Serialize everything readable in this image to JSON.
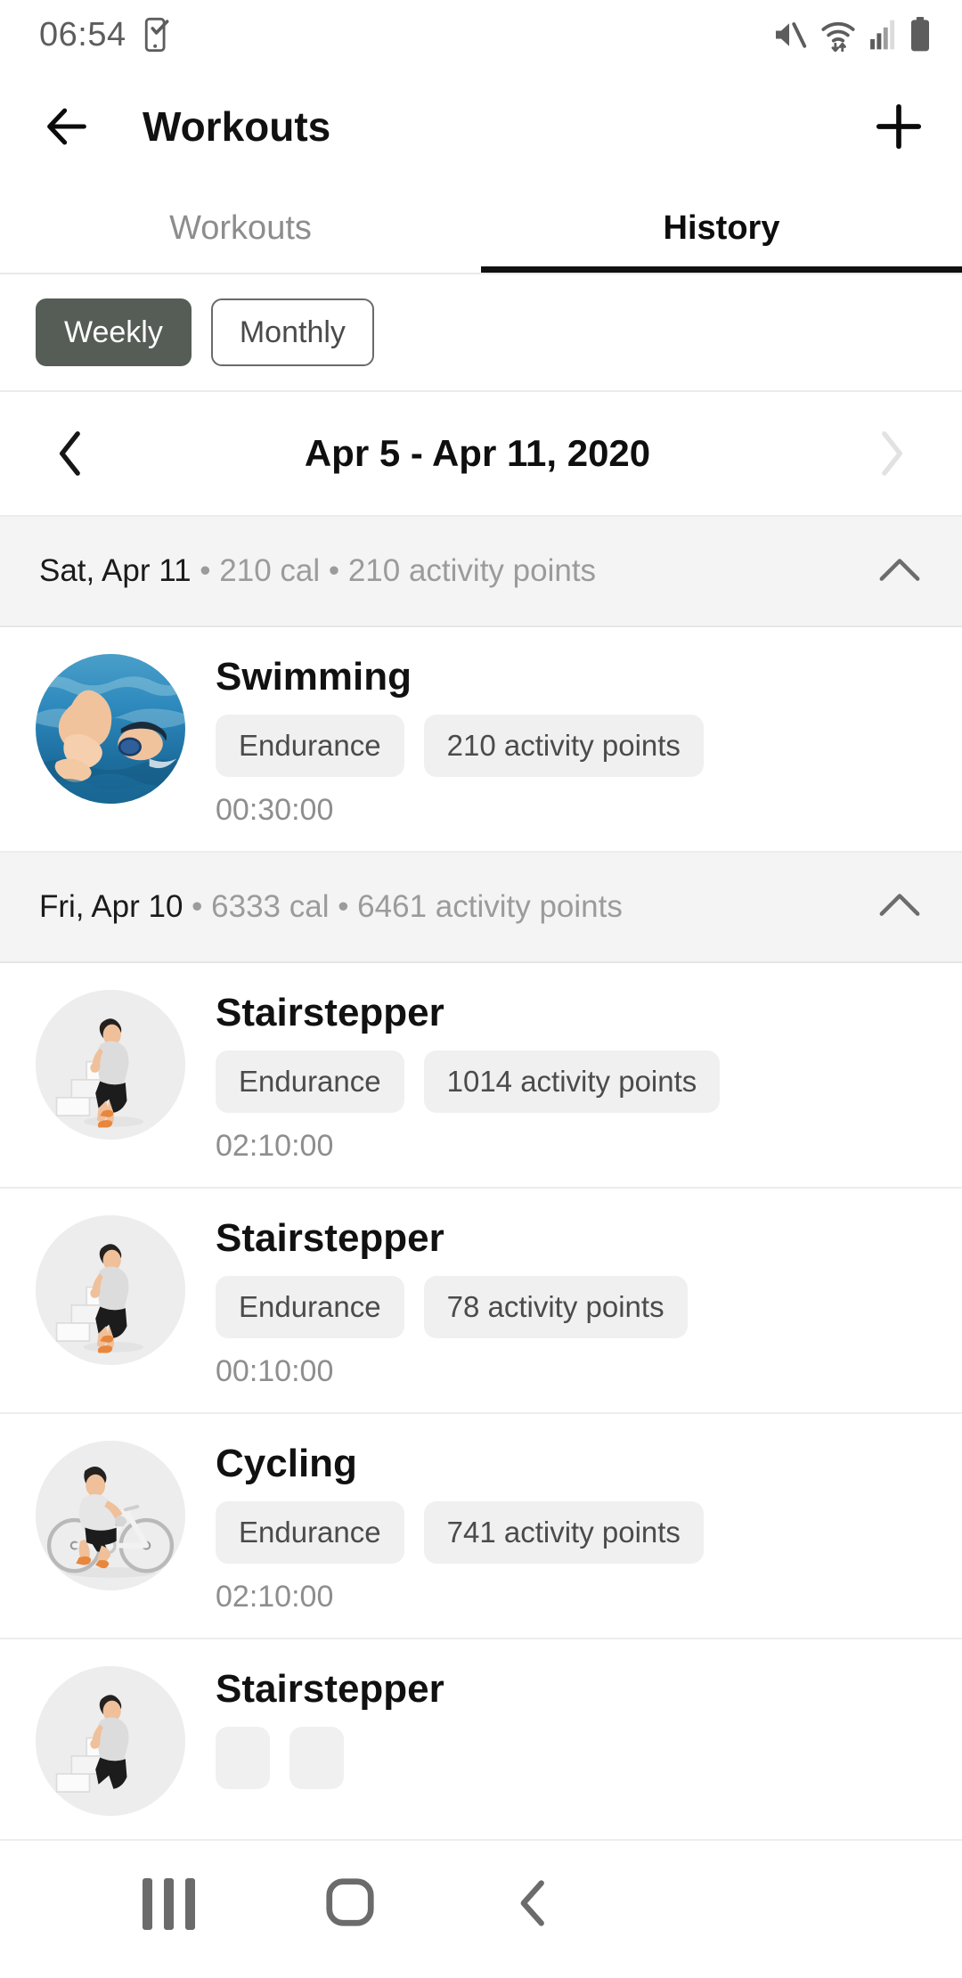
{
  "status_bar": {
    "time": "06:54",
    "left_icons": [
      "phone-checklist-icon"
    ],
    "right_icons": [
      "mute-icon",
      "wifi-icon",
      "signal-icon",
      "battery-icon"
    ]
  },
  "app_bar": {
    "back_label": "back-arrow",
    "title": "Workouts",
    "add_label": "add"
  },
  "tabs": [
    {
      "label": "Workouts",
      "active": false
    },
    {
      "label": "History",
      "active": true
    }
  ],
  "period_toggle": {
    "options": [
      {
        "label": "Weekly",
        "selected": true
      },
      {
        "label": "Monthly",
        "selected": false
      }
    ]
  },
  "date_nav": {
    "prev": "‹",
    "range": "Apr 5 - Apr 11, 2020",
    "next": "›",
    "prev_enabled": true,
    "next_enabled": false
  },
  "groups": [
    {
      "date": "Sat, Apr 11",
      "summary": " • 210 cal • 210 activity points",
      "calories": "210 cal",
      "points": "210 activity points",
      "expanded": true,
      "items": [
        {
          "title": "Swimming",
          "icon": "swimming-photo",
          "type_chip": "Endurance",
          "points_chip": "210 activity points",
          "duration": "00:30:00"
        }
      ]
    },
    {
      "date": "Fri, Apr 10",
      "summary": " • 6333 cal • 6461 activity points",
      "calories": "6333 cal",
      "points": "6461 activity points",
      "expanded": true,
      "items": [
        {
          "title": "Stairstepper",
          "icon": "stairstepper-illustration",
          "type_chip": "Endurance",
          "points_chip": "1014 activity points",
          "duration": "02:10:00"
        },
        {
          "title": "Stairstepper",
          "icon": "stairstepper-illustration",
          "type_chip": "Endurance",
          "points_chip": "78 activity points",
          "duration": "00:10:00"
        },
        {
          "title": "Cycling",
          "icon": "cycling-illustration",
          "type_chip": "Endurance",
          "points_chip": "741 activity points",
          "duration": "02:10:00"
        },
        {
          "title": "Stairstepper",
          "icon": "stairstepper-illustration",
          "type_chip": "",
          "points_chip": "",
          "duration": ""
        }
      ]
    }
  ],
  "nav_bar": {
    "recents": "recents-icon",
    "home": "home-icon",
    "back": "back-icon"
  },
  "colors": {
    "accent_selected": "#565c56",
    "chip_bg": "#f0f0f0",
    "group_header_bg": "#f4f4f4",
    "muted_text": "#8e8e8e"
  }
}
